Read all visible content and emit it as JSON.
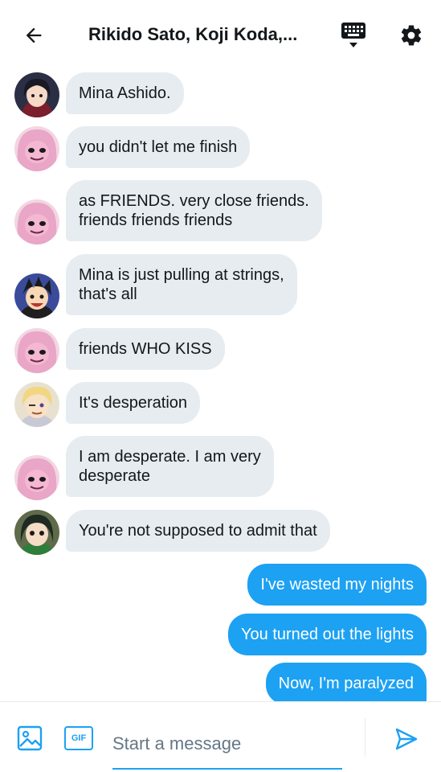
{
  "header": {
    "title": "Rikido Sato, Koji Koda,...",
    "back_icon": "arrow-left-icon",
    "keyboard_icon": "keyboard-icon",
    "settings_icon": "gear-icon"
  },
  "messages": [
    {
      "sender": "avatar-momo",
      "direction": "in",
      "text": "Mina Ashido."
    },
    {
      "sender": "avatar-mina",
      "direction": "in",
      "text": "you didn't let me finish"
    },
    {
      "sender": "avatar-mina",
      "direction": "in",
      "lines": [
        "as FRIENDS. very close friends.",
        "friends friends friends"
      ]
    },
    {
      "sender": "avatar-kirishima",
      "direction": "in",
      "lines": [
        "Mina is just pulling at strings,",
        "that's all"
      ]
    },
    {
      "sender": "avatar-mina",
      "direction": "in",
      "text": "friends WHO KISS"
    },
    {
      "sender": "avatar-aoyama",
      "direction": "in",
      "text": "It's desperation"
    },
    {
      "sender": "avatar-mina",
      "direction": "in",
      "lines": [
        "I am desperate. I am very",
        "desperate"
      ]
    },
    {
      "sender": "avatar-tsuyu",
      "direction": "in",
      "text": "You're not supposed to admit that"
    },
    {
      "direction": "out",
      "text": "I've wasted my nights"
    },
    {
      "direction": "out",
      "text": "You turned out the lights"
    },
    {
      "direction": "out",
      "text": "Now, I'm paralyzed"
    }
  ],
  "composer": {
    "placeholder": "Start a message",
    "gif_label": "GIF",
    "media_icon": "image-icon",
    "send_icon": "send-icon"
  },
  "colors": {
    "accent": "#1da1f2",
    "incoming_bubble": "#e6ecf0",
    "text": "#14171a",
    "placeholder": "#657786"
  }
}
